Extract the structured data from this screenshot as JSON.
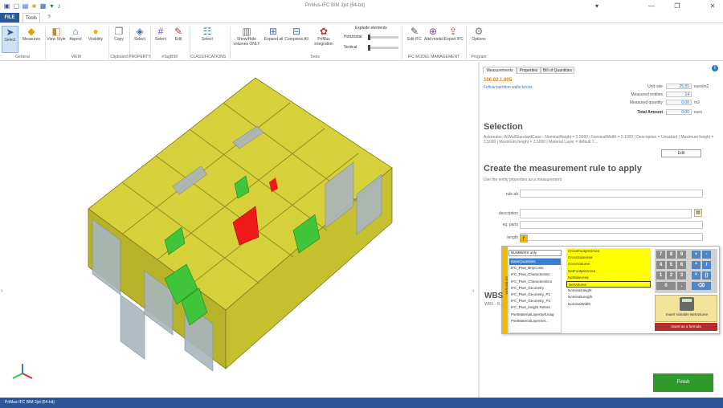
{
  "app": {
    "title": "PriMus-IFC BIM 2jxt (64-bit)"
  },
  "quick_access": [
    "new-icon",
    "open-icon",
    "folder-icon",
    "save-icon",
    "dropdown-icon",
    "microphone-icon"
  ],
  "window_controls": {
    "menu": "▾",
    "minimize": "—",
    "restore": "❐",
    "close": "✕"
  },
  "tabs": {
    "file": "FILE",
    "tools": "Tools",
    "help": "?"
  },
  "ribbon": {
    "buttons": {
      "select": "Select",
      "measures": "Measures",
      "view_style": "View Style",
      "aspect": "Aspect",
      "visibility": "Visibility",
      "copy": "Copy",
      "property_select": "Select",
      "tagbim_select": "Select",
      "tagbim_edit": "Edit",
      "class_select": "Select",
      "showhide": "Show/Hide volumes ONLY",
      "expand_all": "Expand all",
      "compress_all": "Compress All",
      "primus_integration": "PriMus integration",
      "edit_ifc": "Edit IFC",
      "add_model": "Add model",
      "export_ifc": "Export IFC",
      "options": "Options"
    },
    "groups": {
      "general": "General",
      "view": "VIEW",
      "clipboard": "Clipboard",
      "property": "PROPERTY",
      "tagbim": "#TagBIM",
      "classifications": "CLASSIFICATIONS",
      "tools": "Tools",
      "ifc_model": "IFC MODEL MANAGEMENT",
      "program": "Program"
    },
    "explode": {
      "title": "Explode elements",
      "horizontal": "Horizontal",
      "vertical": "Vertical"
    }
  },
  "panel": {
    "tabs": [
      "Measurements",
      "Properties",
      "Bill of Quantities"
    ],
    "code": "106.02.1.005",
    "code_desc": "Fellow partition walls bricks",
    "unit_rate_label": "Unit rate",
    "unit_rate": "25.55",
    "unit_rate_unit": "euro/m2",
    "entities_label": "Measured entities",
    "entities": "14",
    "quantity_label": "Measured quantity",
    "quantity": "0.00",
    "quantity_unit": "m2",
    "total_label": "Total Amount",
    "total": "0.00",
    "total_unit": "euro",
    "selection_title": "Selection",
    "selection_desc": "Automatic: IfcWallStandardCase - NominalHeight = 3.5000 | NominalWidth = 0.1000 | Description = Unsaturd | Maximum height = 3.5000 | Maximum height = 3.5000 | Material Layer = default 7...",
    "edit_label": "Edit",
    "rule_title": "Create the measurement rule to apply",
    "rule_subtitle": "Use the entity properties as a measurement",
    "rule_labels": {
      "rule": "rule ab",
      "description": "description",
      "equal_parts": "eq. parts",
      "length": "length"
    },
    "wbs_title": "WBS",
    "wbs_sub": "WBS - R...",
    "finish": "Finish"
  },
  "popup": {
    "strip_label": "VARIABLES",
    "category_select": "NUMBERS only",
    "categories": [
      "BaseQuantities",
      "IFC_Pset_BIQCosts",
      "IFC_Pset_Characteristic",
      "IFC_Pset_Characteristics",
      "IFC_Pset_Geometry",
      "IFC_Pset_Geometry_P1",
      "IFC_Pset_Geometry_P2",
      "IFC_Pset_Height Refere",
      "PsetMaterialLayerSetUsag",
      "PsetMaterialLayerSet..."
    ],
    "properties": [
      "GrossFootprintArea",
      "GrossSideArea",
      "GrossVolume",
      "NetFootprintArea",
      "NetSideArea",
      "NetVolume",
      "NominalHeight",
      "NominalLength",
      "NominalWidth"
    ],
    "keys": [
      "7",
      "8",
      "9",
      "+",
      "-",
      "4",
      "5",
      "6",
      "*",
      "/",
      "1",
      "2",
      "3",
      "^",
      "()",
      "0",
      ".",
      "⌫"
    ],
    "insert_variable": "Insert Variable NetVolume",
    "insert_formula": "Insert as a formula"
  },
  "status": {
    "text": "PriMus-IFC BIM 2jxt (64-bit)"
  },
  "colors": {
    "accent": "#2b579a",
    "model": "#d1cc30",
    "highlight_red": "#ee1a1a",
    "highlight_green": "#3fc43c",
    "finish": "#2f9a2a"
  }
}
